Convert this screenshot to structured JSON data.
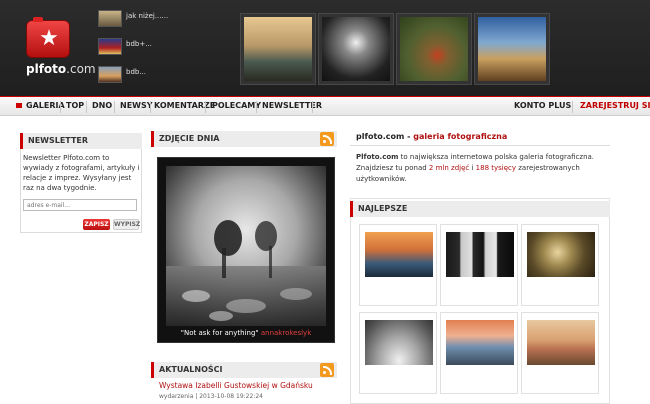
{
  "header": {
    "logo_main": "plfoto",
    "logo_suffix": ".com",
    "mini_items": [
      {
        "label": "jak niżej......"
      },
      {
        "label": "bdb+..."
      },
      {
        "label": "bdb..."
      }
    ]
  },
  "nav": {
    "items": [
      "GALERIA",
      "TOP",
      "DNO",
      "NEWSY",
      "KOMENTARZE",
      "POLECAMY",
      "NEWSLETTER"
    ],
    "konto": "KONTO PLUS",
    "register": "ZAREJESTRUJ SIĘ"
  },
  "newsletter": {
    "title": "NEWSLETTER",
    "text": "Newsletter Plfoto.com to wywiady z fotografami, artykuły i relacje z imprez. Wysyłany jest raz na dwa tygodnie.",
    "input_placeholder": "adres e-mail...",
    "subscribe": "ZAPISZ",
    "unsubscribe": "WYPISZ"
  },
  "photo_of_day": {
    "title": "ZDJĘCIE DNIA",
    "caption": "\"Not ask for anything\"",
    "author": "annakrokeslyk"
  },
  "news": {
    "title": "AKTUALNOŚCI",
    "headline": "Wystawa Izabelli Gustowskiej w Gdańsku",
    "meta": "wydarzenia | 2013-10-08 19:22:24"
  },
  "intro": {
    "site": "plfoto.com",
    "separator": " - ",
    "tagline": "galeria fotograficzna",
    "text_1": "Plfoto.com",
    "text_2": " to największa internetowa polska galeria fotograficzna. Znajdziesz tu ponad ",
    "photos": "2 mln zdjęć",
    "text_3": " i ",
    "users": "188 tysięcy",
    "text_4": " zarejestrowanych użytkowników."
  },
  "best": {
    "title": "NAJLEPSZE"
  }
}
